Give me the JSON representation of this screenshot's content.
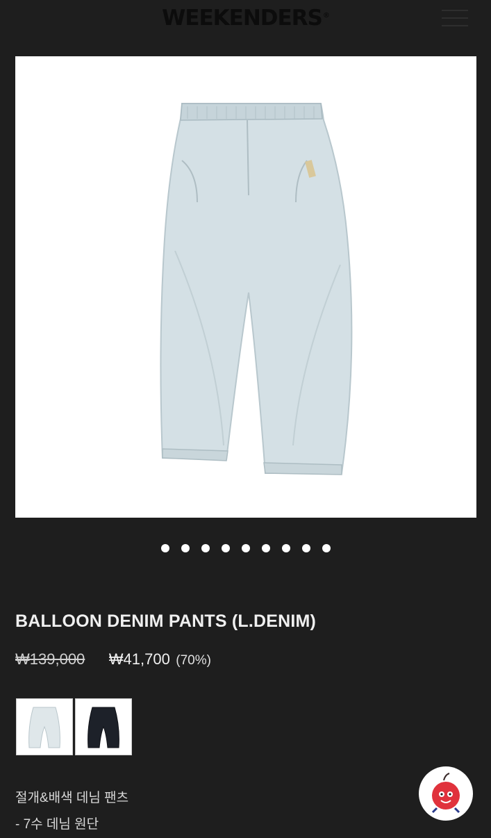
{
  "header": {
    "logo_text": "WEEKENDERS",
    "logo_mark": "®",
    "menu_icon": "hamburger-menu-icon"
  },
  "gallery": {
    "slide_count": 9,
    "active_slide": 1
  },
  "product": {
    "name": "BALLOON DENIM PANTS (L.DENIM)",
    "original_price": "₩139,000",
    "sale_price": "₩41,700",
    "discount": "(70%)"
  },
  "options": {
    "colors": [
      {
        "name": "light-denim",
        "color": "#dfe7ea"
      },
      {
        "name": "black",
        "color": "#1d2129"
      }
    ]
  },
  "description": {
    "line1": "절개&배색 데님 팬츠",
    "line2": "- 7수 데님 원단"
  },
  "colors": {
    "background": "#1e1e1e",
    "text": "#f0f0f0",
    "chat_mascot": "#e0323c"
  },
  "chat_icon": "apple-mascot-chat-icon"
}
